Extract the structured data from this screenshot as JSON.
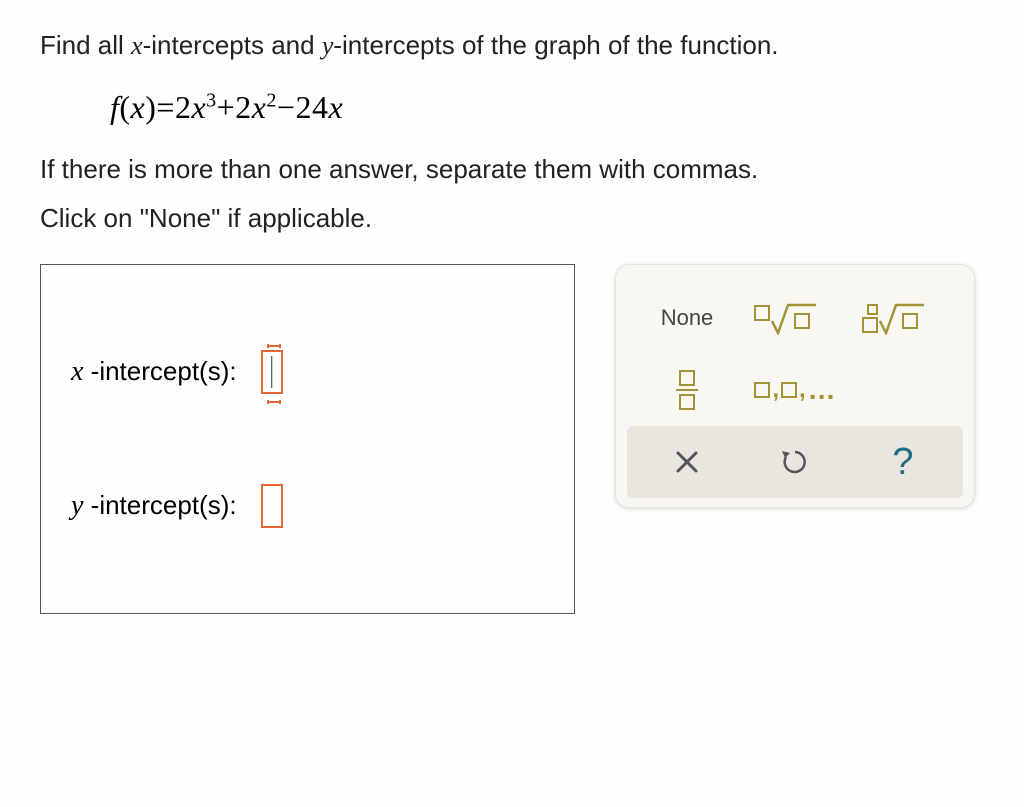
{
  "question": {
    "prompt_before_x": "Find all ",
    "x_var": "x",
    "mid1": "-intercepts and ",
    "y_var": "y",
    "mid2": "-intercepts of the graph of the function.",
    "instruction1": "If there is more than one answer, separate them with commas.",
    "instruction2": "Click on \"None\" if applicable."
  },
  "equation": {
    "lhs_f": "f",
    "lhs_open": "(",
    "lhs_x": "x",
    "lhs_close": ")",
    "eq": "=",
    "t1_coef": "2",
    "t1_var": "x",
    "t1_exp": "3",
    "op1": "+",
    "t2_coef": "2",
    "t2_var": "x",
    "t2_exp": "2",
    "op2": "−",
    "t3_coef": "24",
    "t3_var": "x"
  },
  "answer": {
    "x_label_var": "x",
    "x_label_rest": " -intercept(s):",
    "x_value": "",
    "y_label_var": "y",
    "y_label_rest": " -intercept(s):",
    "y_value": ""
  },
  "keypad": {
    "none_label": "None",
    "comma_list": "…",
    "clear": "×",
    "undo": "↺",
    "help": "?"
  }
}
